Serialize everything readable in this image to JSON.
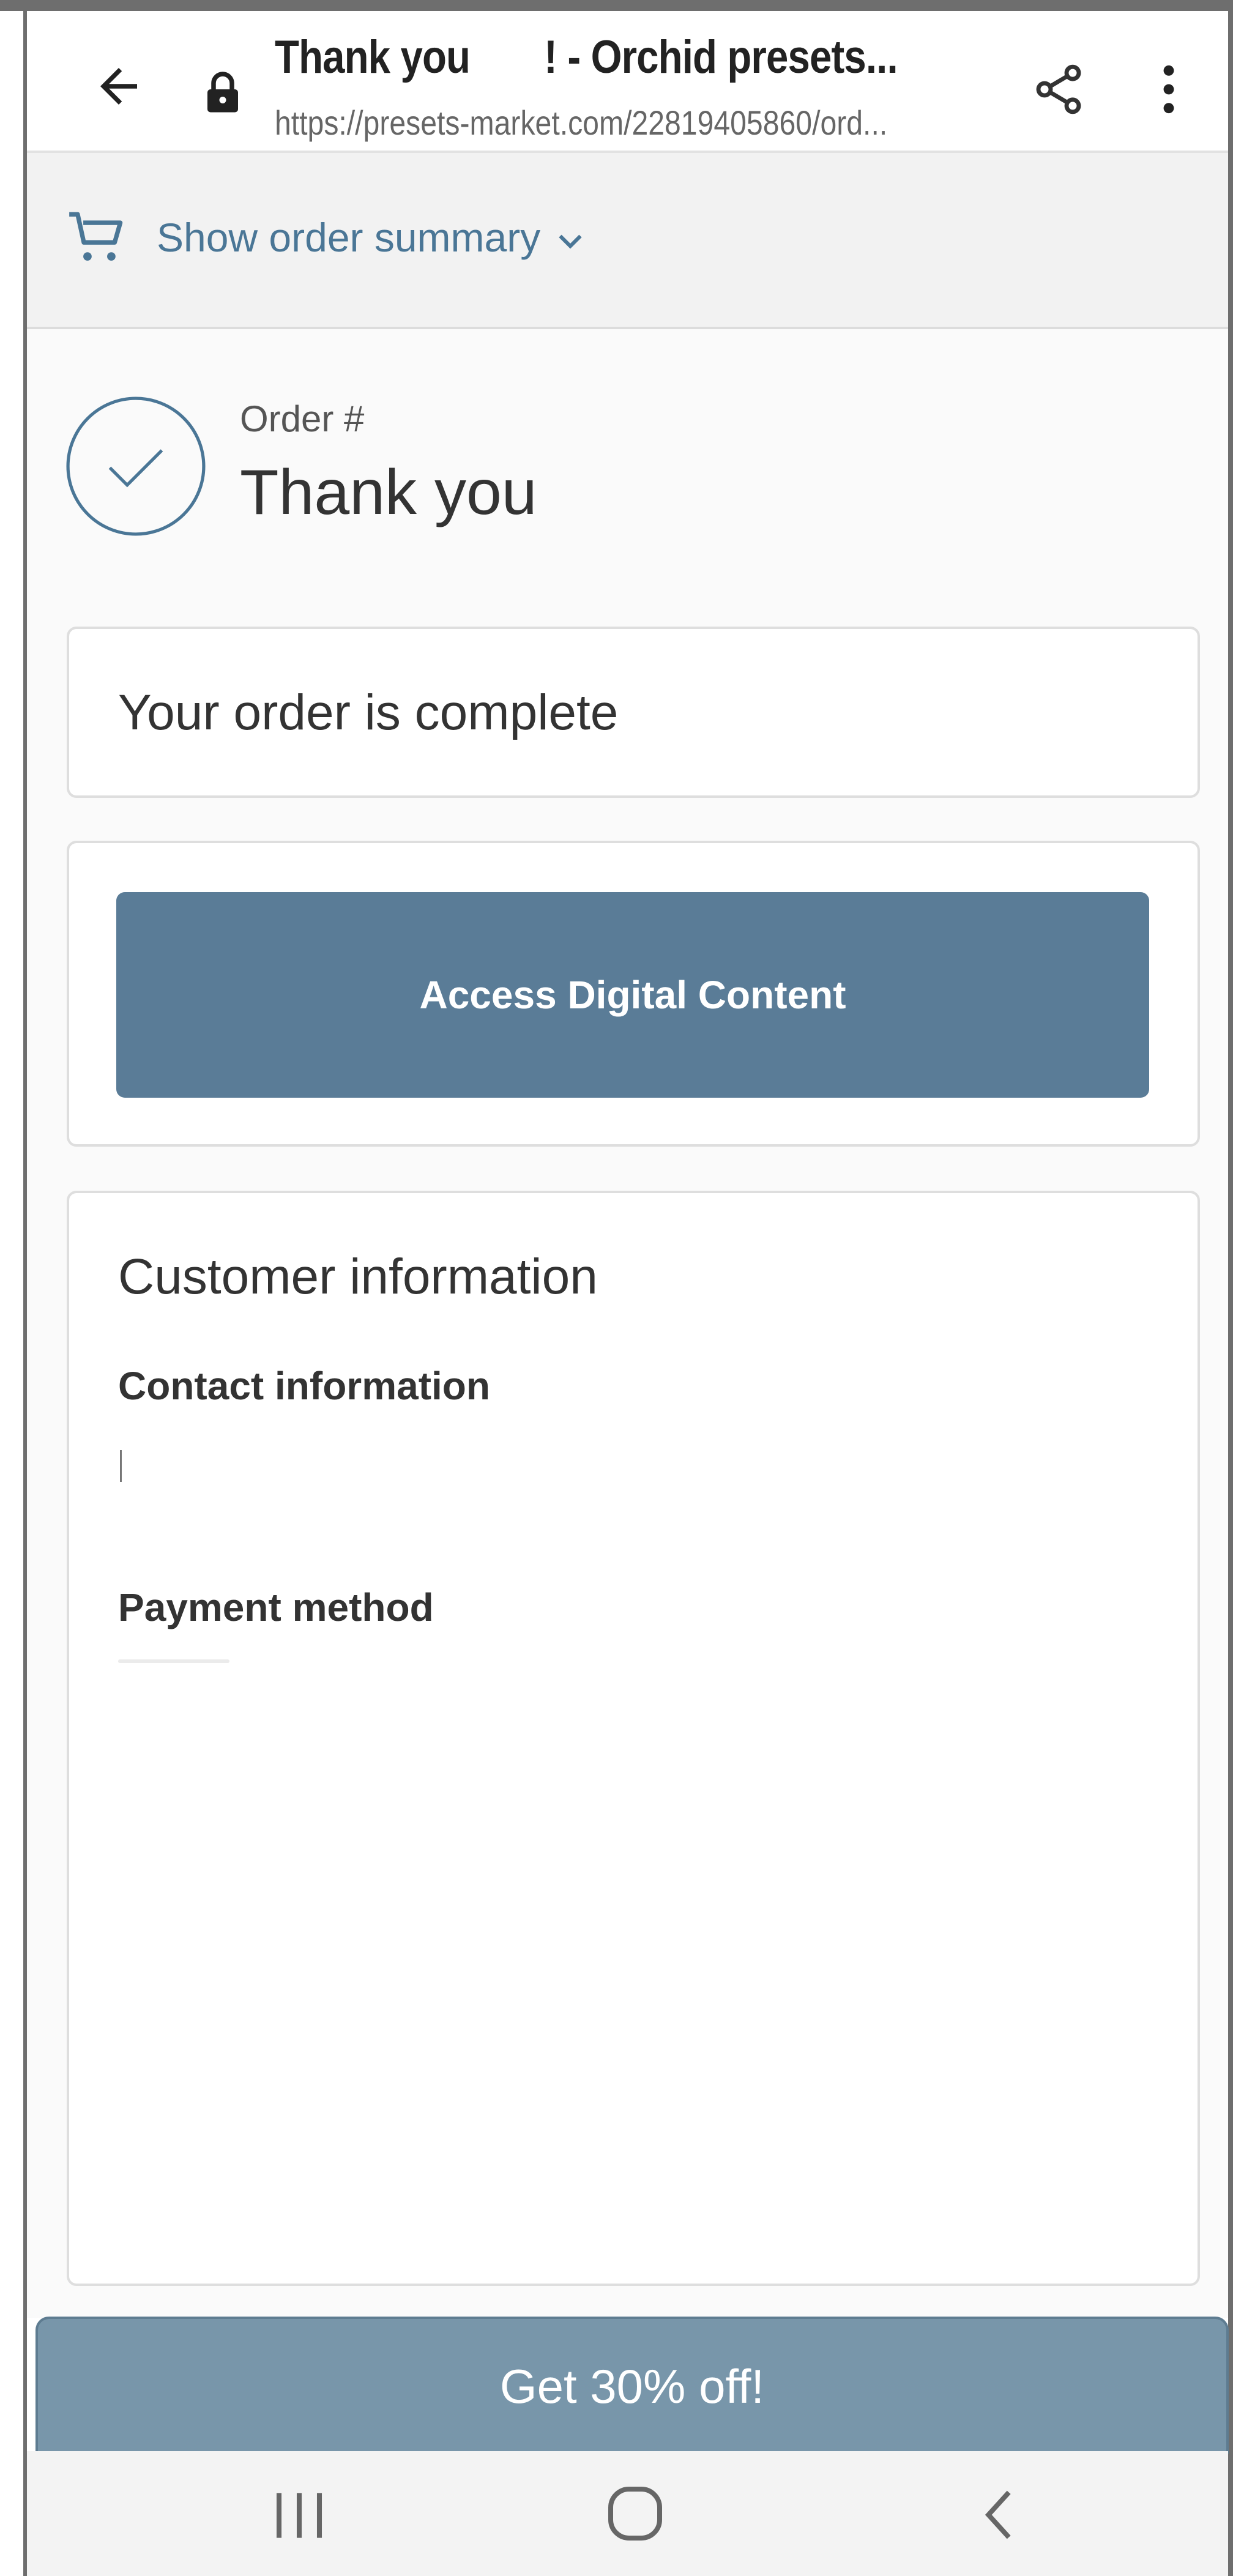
{
  "browser": {
    "title": "Thank you       ! - Orchid presets...",
    "url": "https://presets-market.com/22819405860/ord..."
  },
  "summary": {
    "label": "Show order summary"
  },
  "order": {
    "number_label": "Order #",
    "heading": "Thank you"
  },
  "status": {
    "text": "Your order is complete"
  },
  "access": {
    "button_label": "Access Digital Content"
  },
  "customer": {
    "heading": "Customer information",
    "contact_heading": "Contact information",
    "payment_heading": "Payment method"
  },
  "promo": {
    "label": "Get 30% off!"
  },
  "colors": {
    "accent": "#5a7c97",
    "link": "#4a7696",
    "promo": "#7896aa"
  },
  "icons": [
    "back-arrow-icon",
    "lock-icon",
    "share-icon",
    "more-vert-icon",
    "cart-icon",
    "chevron-down-icon",
    "check-circle-icon",
    "recents-icon",
    "home-icon",
    "nav-back-icon"
  ]
}
